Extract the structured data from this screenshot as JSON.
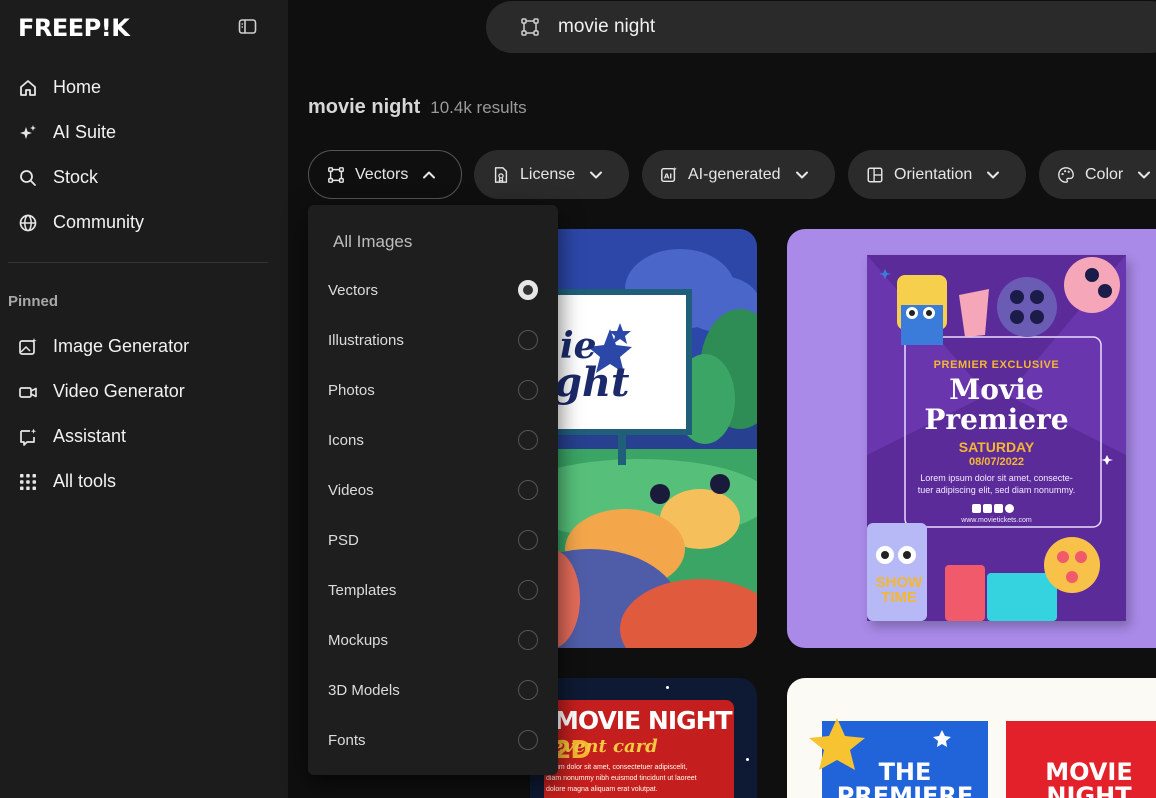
{
  "brand": {
    "logo": "FREEP!K"
  },
  "sidebar": {
    "nav": [
      {
        "label": "Home",
        "icon": "home-icon"
      },
      {
        "label": "AI Suite",
        "icon": "sparkle-icon"
      },
      {
        "label": "Stock",
        "icon": "search-icon"
      },
      {
        "label": "Community",
        "icon": "globe-icon"
      }
    ],
    "pinned_heading": "Pinned",
    "pinned": [
      {
        "label": "Image Generator",
        "icon": "image-generator-icon"
      },
      {
        "label": "Video Generator",
        "icon": "video-camera-icon"
      },
      {
        "label": "Assistant",
        "icon": "assistant-icon"
      },
      {
        "label": "All tools",
        "icon": "grid-icon"
      }
    ]
  },
  "search": {
    "query": "movie night"
  },
  "results": {
    "title": "movie night",
    "count": "10.4k results"
  },
  "filters": [
    {
      "label": "Vectors",
      "icon": "vectors-icon",
      "open": true
    },
    {
      "label": "License",
      "icon": "license-icon"
    },
    {
      "label": "AI-generated",
      "icon": "ai-generated-icon"
    },
    {
      "label": "Orientation",
      "icon": "orientation-icon"
    },
    {
      "label": "Color",
      "icon": "palette-icon"
    }
  ],
  "dropdown": {
    "all_label": "All Images",
    "options": [
      "Vectors",
      "Illustrations",
      "Photos",
      "Icons",
      "Videos",
      "PSD",
      "Templates",
      "Mockups",
      "3D Models",
      "Fonts"
    ],
    "selected": "Vectors"
  },
  "cards": {
    "night_card": {
      "text_a": "ie",
      "text_b": "ght"
    },
    "premiere": {
      "kicker": "PREMIER EXCLUSIVE",
      "title_1": "Movie",
      "title_2": "Premiere",
      "day": "SATURDAY",
      "date": "08/07/2022",
      "body_1": "Lorem ipsum dolor sit amet, consecte-",
      "body_2": "tuer adipiscing elit, sed diam nonummy.",
      "site": "www.movietickets.com",
      "badge": "SHOW TIME"
    },
    "event_card": {
      "title": "MOVIE NIGHT",
      "tag": "2D",
      "sub": "event card",
      "body_1": "ipsum dolor sit amet, consectetuer adipiscelit,",
      "body_2": "diam nonummy nibh euismod tincidunt ut laoreet",
      "body_3": "dolore magna aliquam erat volutpat."
    },
    "last_card": {
      "left": "THE PREMIERE",
      "right": "MOVIE NIGHT"
    }
  },
  "colors": {
    "bg": "#0f0f0f",
    "sidebar": "#1c1c1c",
    "purple": "#a98ae8",
    "poster": "#5c2b9a",
    "accent": "#f5b731"
  }
}
